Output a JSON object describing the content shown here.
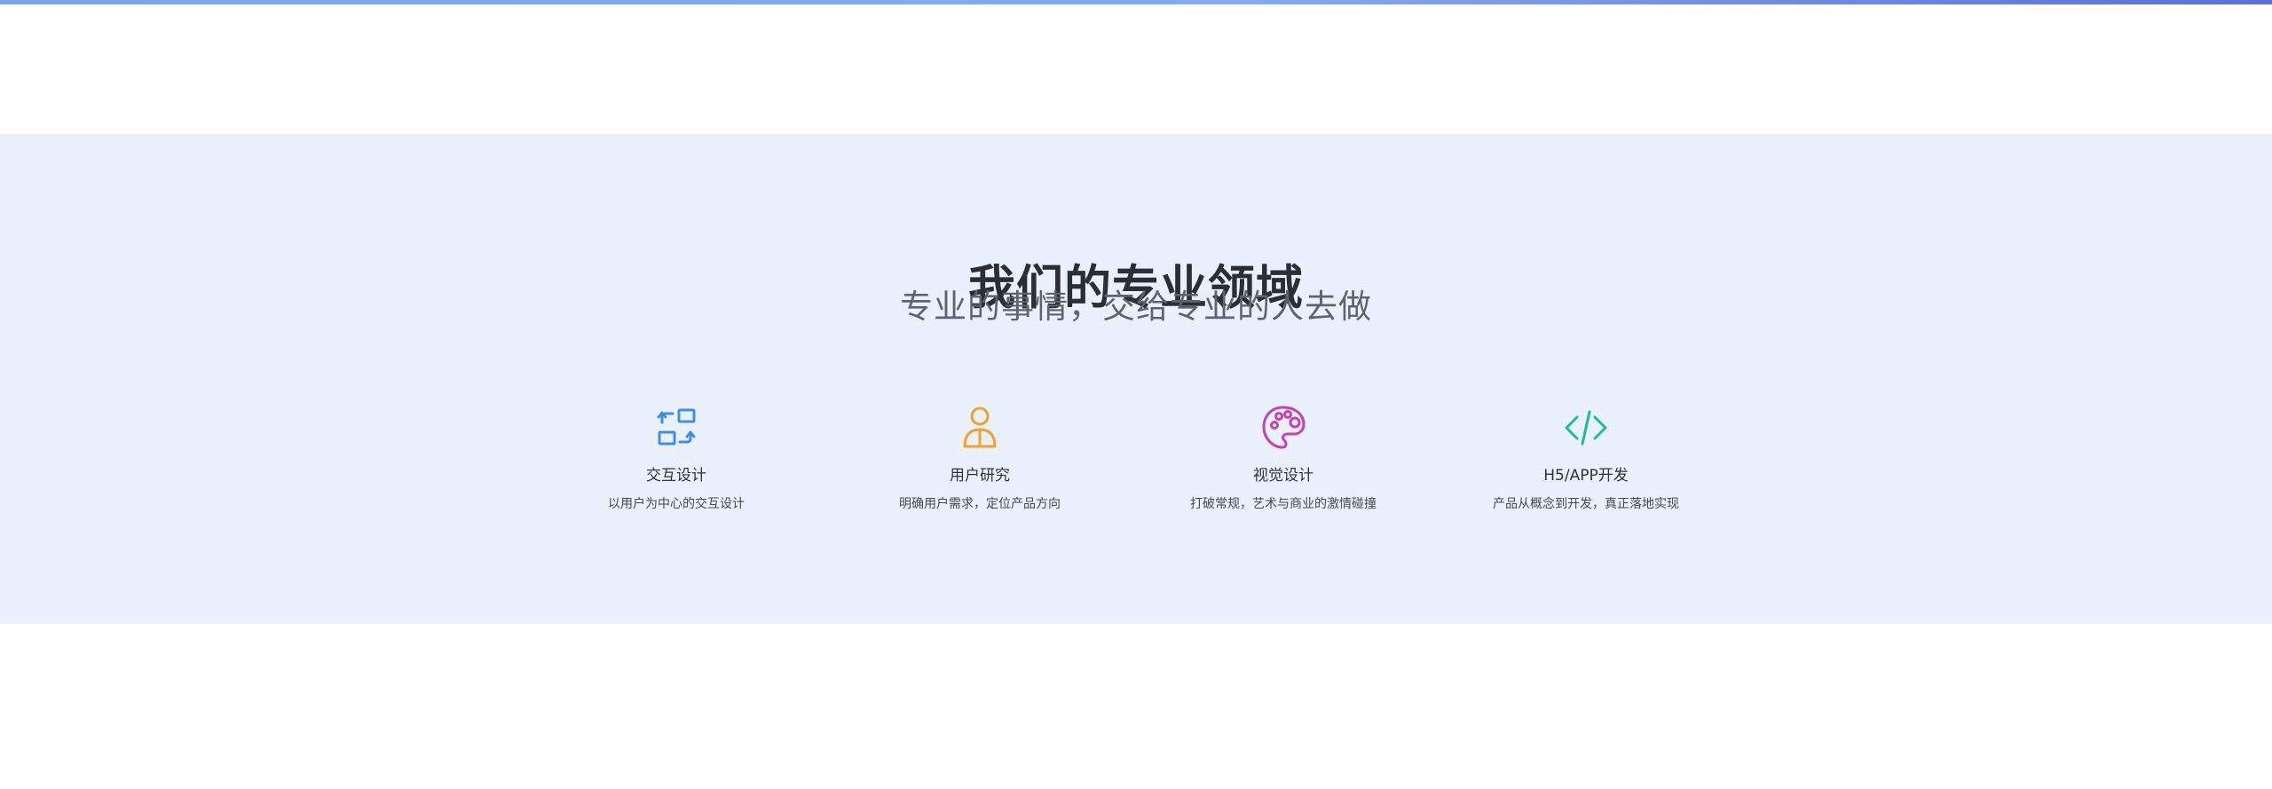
{
  "section": {
    "title": "我们的专业领域",
    "subtitle": "专业的事情，交给专业的人去做"
  },
  "features": [
    {
      "name": "交互设计",
      "desc": "以用户为中心的交互设计",
      "icon": "interaction-swap-icon",
      "color": "#3d8fe6"
    },
    {
      "name": "用户研究",
      "desc": "明确用户需求，定位产品方向",
      "icon": "user-research-icon",
      "color": "#f0a12e"
    },
    {
      "name": "视觉设计",
      "desc": "打破常规，艺术与商业的激情碰撞",
      "icon": "palette-icon",
      "color": "#c93fb8"
    },
    {
      "name": "H5/APP开发",
      "desc": "产品从概念到开发，真正落地实现",
      "icon": "code-icon",
      "color": "#19c08f"
    }
  ],
  "colors": {
    "band_background": "#eaf1fd",
    "top_bar_start": "#7aa3f0",
    "top_bar_end": "#5b6ee0"
  }
}
